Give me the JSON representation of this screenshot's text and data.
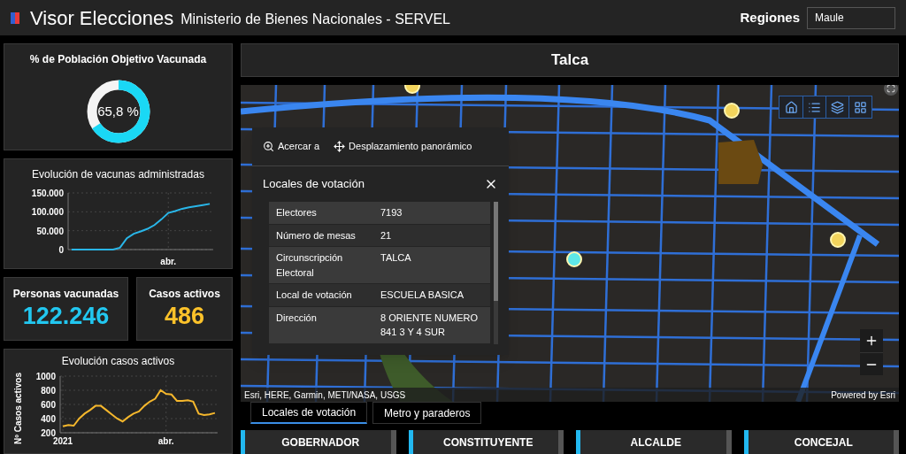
{
  "header": {
    "title": "Visor Elecciones",
    "subtitle": "Ministerio de Bienes Nacionales - SERVEL",
    "region_label": "Regiones",
    "region_value": "Maule"
  },
  "vaccinated_share": {
    "title": "% de Población Objetivo Vacunada",
    "reading": "65,8 %",
    "level": 0.658
  },
  "vaccine_chart": {
    "title": "Evolución de vacunas administradas",
    "chart_data": {
      "type": "line",
      "grid": true,
      "categories": [
        null,
        null,
        null,
        null,
        null,
        null,
        null,
        null,
        null,
        null,
        null,
        null,
        null,
        null,
        "abr.",
        null,
        null,
        null,
        null,
        null,
        null
      ],
      "ylim": [
        0,
        150000
      ],
      "yticks": [
        {
          "value": 0,
          "label": "0"
        },
        {
          "value": 50000,
          "label": "50.000"
        },
        {
          "value": 100000,
          "label": "100.000"
        },
        {
          "value": 150000,
          "label": "150.000"
        }
      ],
      "series": [
        {
          "color": "#29b6e8",
          "values": [
            0,
            0,
            0,
            0,
            0,
            0,
            0,
            5000,
            30000,
            42000,
            48000,
            55000,
            65000,
            80000,
            97000,
            102000,
            108000,
            112000,
            115000,
            118000,
            121000
          ]
        }
      ]
    }
  },
  "stats": [
    {
      "label": "Personas vacunadas",
      "value": "122.246",
      "color": "#22c7f0"
    },
    {
      "label": "Casos activos",
      "value": "486",
      "color": "#fcc22a"
    }
  ],
  "cases_chart": {
    "title": "Evolución casos activos",
    "chart_data": {
      "type": "line",
      "grid": true,
      "ylabel": "Nº Casos activos",
      "categories": [
        "2021",
        null,
        null,
        null,
        null,
        null,
        null,
        null,
        null,
        null,
        null,
        null,
        null,
        null,
        null,
        null,
        null,
        null,
        null,
        "abr.",
        null,
        null,
        null,
        null,
        null,
        null,
        null,
        null,
        null
      ],
      "ylim": [
        200,
        1000
      ],
      "yticks": [
        200,
        400,
        600,
        800,
        1000
      ],
      "series": [
        {
          "color": "#f5b72c",
          "values": [
            290,
            310,
            300,
            400,
            470,
            520,
            580,
            580,
            520,
            460,
            400,
            360,
            420,
            470,
            500,
            580,
            640,
            680,
            800,
            750,
            740,
            650,
            650,
            660,
            640,
            470,
            450,
            460,
            480
          ]
        }
      ]
    }
  },
  "place_title": "Talca",
  "map": {
    "attribution": "Esri, HERE, Garmin, METI/NASA, USGS",
    "powered_by": "Powered by Esri",
    "popup": {
      "actions": [
        "Acercar a",
        "Desplazamiento panorámico"
      ],
      "title": "Locales de votación",
      "rows": [
        {
          "label": "Electores",
          "value": "7193"
        },
        {
          "label": "Número de mesas",
          "value": "21"
        },
        {
          "label": "Circunscripción Electoral",
          "value": "TALCA"
        },
        {
          "label": "Local de votación",
          "value": "ESCUELA BASICA"
        },
        {
          "label": "Dirección",
          "value": "8 ORIENTE NUMERO 841 3 Y 4 SUR"
        }
      ]
    }
  },
  "tabs": [
    {
      "label": "Locales de votación",
      "selected": true
    },
    {
      "label": "Metro y paraderos",
      "selected": false
    }
  ],
  "result_cards": [
    "GOBERNADOR",
    "CONSTITUYENTE",
    "ALCALDE",
    "CONCEJAL"
  ]
}
